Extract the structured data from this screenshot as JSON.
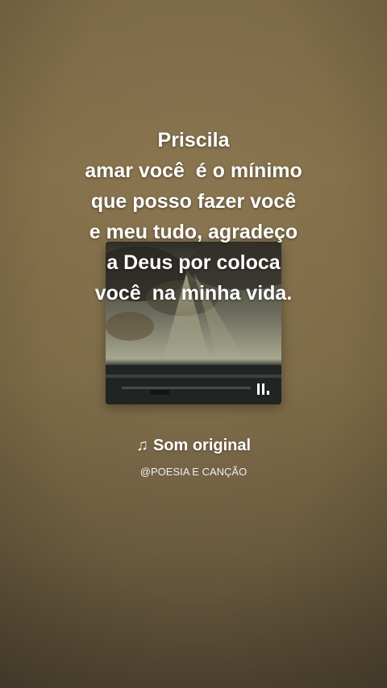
{
  "lyrics": [
    "Priscila",
    "amar você  é o mínimo",
    "que posso fazer você",
    "e meu tudo, agradeço",
    "a Deus por coloca",
    "você  na minha vida."
  ],
  "sound": {
    "note_icon": "♫",
    "title": "Som original",
    "author": "@POESIA E CANÇÃO"
  },
  "icons": {
    "playing": "equalizer-bars-icon"
  },
  "colors": {
    "background": "#7d6a48",
    "text": "#ffffff"
  }
}
